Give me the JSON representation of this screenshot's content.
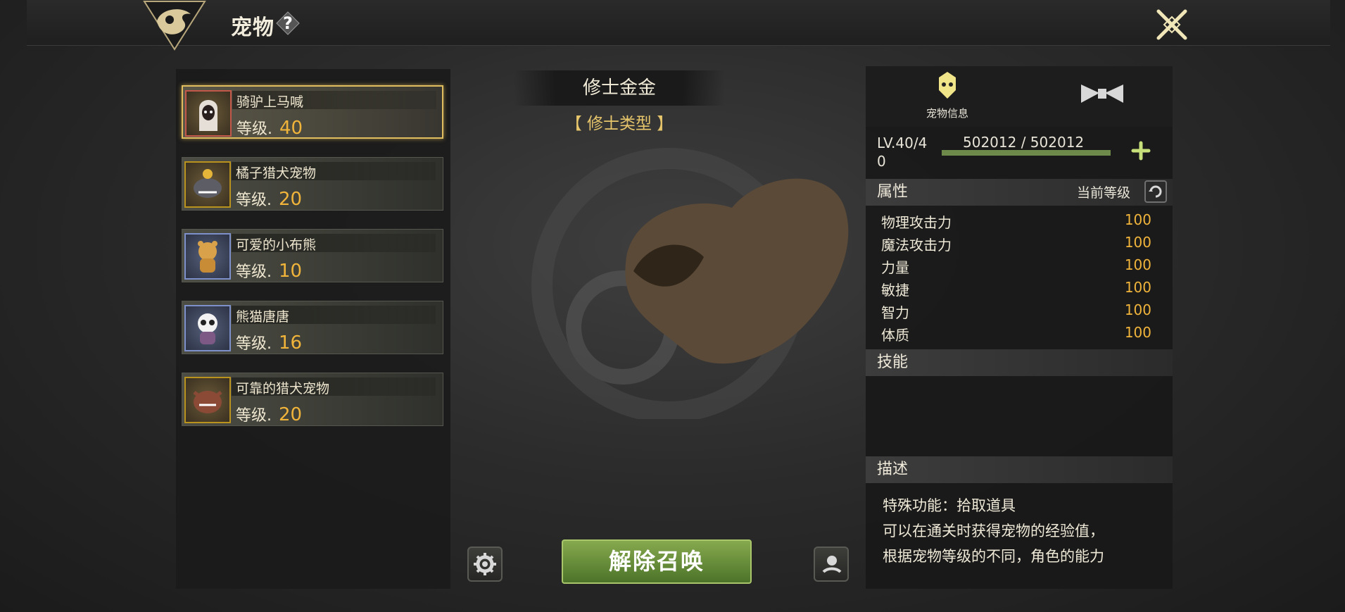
{
  "header": {
    "title": "宠物",
    "help_glyph": "?"
  },
  "pets": [
    {
      "name": "骑驴上马喊",
      "level_label": "等级.",
      "level": "40"
    },
    {
      "name": "橘子猎犬宠物",
      "level_label": "等级.",
      "level": "20"
    },
    {
      "name": "可爱的小布熊",
      "level_label": "等级.",
      "level": "10"
    },
    {
      "name": "熊猫唐唐",
      "level_label": "等级.",
      "level": "16"
    },
    {
      "name": "可靠的猎犬宠物",
      "level_label": "等级.",
      "level": "20"
    }
  ],
  "selected": {
    "name": "修士金金",
    "type": "【 修士类型 】"
  },
  "actions": {
    "summon_label": "解除召唤"
  },
  "tabs": [
    {
      "label": "宠物信息",
      "icon": "pet-face-icon"
    },
    {
      "label": "",
      "icon": "bow-icon"
    }
  ],
  "info": {
    "lv_line1": "LV.40/4",
    "lv_line2": "0",
    "hp": "502012 / 502012",
    "attr_title": "属性",
    "current_level": "当前等级",
    "stats": [
      {
        "name": "物理攻击力",
        "value": "100"
      },
      {
        "name": "魔法攻击力",
        "value": "100"
      },
      {
        "name": "力量",
        "value": "100"
      },
      {
        "name": "敏捷",
        "value": "100"
      },
      {
        "name": "智力",
        "value": "100"
      },
      {
        "name": "体质",
        "value": "100"
      }
    ],
    "skills_title": "技能",
    "desc_title": "描述",
    "desc_lines": [
      "特殊功能：拾取道具",
      "可以在通关时获得宠物的经验值，",
      "根据宠物等级的不同，角色的能力"
    ]
  },
  "colors": {
    "accent_gold": "#f1b43b",
    "button_green": "#6b8f3c",
    "active_border": "#e0bd5e"
  }
}
